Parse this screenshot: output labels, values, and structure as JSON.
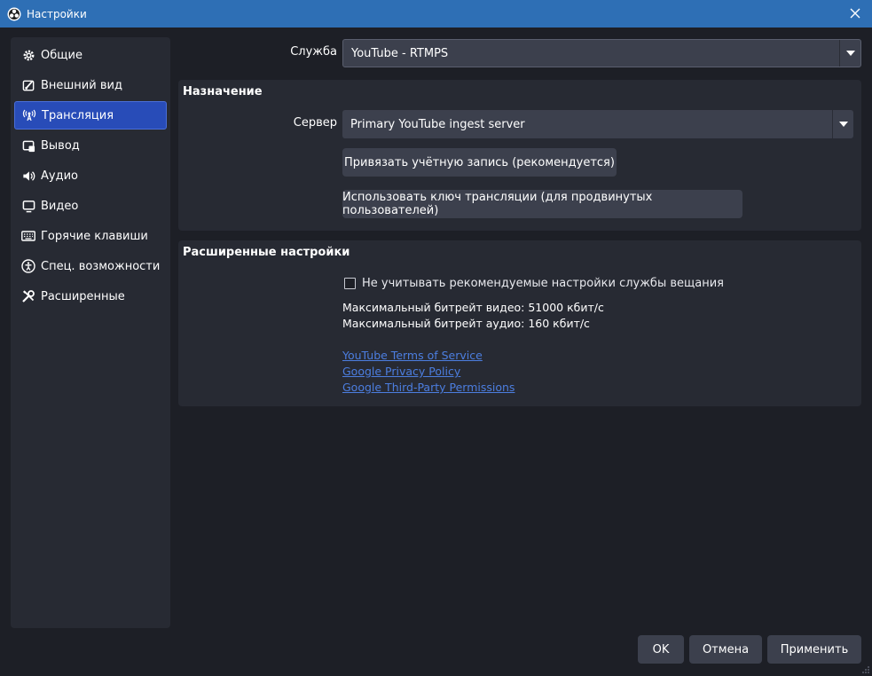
{
  "window": {
    "title": "Настройки"
  },
  "sidebar": {
    "items": [
      {
        "label": "Общие",
        "icon": "gear-icon"
      },
      {
        "label": "Внешний вид",
        "icon": "palette-icon"
      },
      {
        "label": "Трансляция",
        "icon": "broadcast-icon",
        "active": true
      },
      {
        "label": "Вывод",
        "icon": "output-icon"
      },
      {
        "label": "Аудио",
        "icon": "speaker-icon"
      },
      {
        "label": "Видео",
        "icon": "monitor-icon"
      },
      {
        "label": "Горячие клавиши",
        "icon": "keyboard-icon"
      },
      {
        "label": "Спец. возможности",
        "icon": "accessibility-icon"
      },
      {
        "label": "Расширенные",
        "icon": "tools-icon"
      }
    ]
  },
  "service": {
    "label": "Служба",
    "value": "YouTube - RTMPS"
  },
  "destination": {
    "title": "Назначение",
    "server_label": "Сервер",
    "server_value": "Primary YouTube ingest server",
    "connect_account_button": "Привязать учётную запись (рекомендуется)",
    "use_stream_key_button": "Использовать ключ трансляции (для продвинутых пользователей)"
  },
  "advanced": {
    "title": "Расширенные настройки",
    "ignore_recommended_label": "Не учитывать рекомендуемые настройки службы вещания",
    "ignore_recommended_checked": false,
    "max_video_bitrate": "Максимальный битрейт видео: 51000 кбит/с",
    "max_audio_bitrate": "Максимальный битрейт аудио: 160 кбит/с",
    "links": [
      "YouTube Terms of Service",
      "Google Privacy Policy",
      "Google Third-Party Permissions"
    ]
  },
  "footer": {
    "ok": "OK",
    "cancel": "Отмена",
    "apply": "Применить"
  },
  "colors": {
    "background": "#1d1f26",
    "panel": "#272a33",
    "control": "#3c404d",
    "titlebar": "#2e6fb5",
    "accent": "#284cb8",
    "link": "#4c7ee0"
  }
}
